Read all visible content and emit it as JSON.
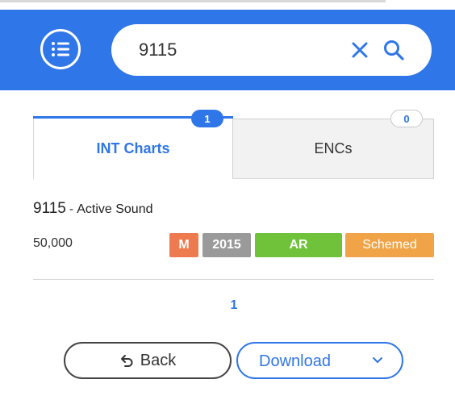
{
  "search": {
    "value": "9115"
  },
  "tabs": [
    {
      "label": "INT Charts",
      "count": "1",
      "active": true
    },
    {
      "label": "ENCs",
      "count": "0",
      "active": false
    }
  ],
  "chart": {
    "number": "9115",
    "separator": " - ",
    "name": "Active Sound",
    "scale": "50,000",
    "tags": {
      "type": "M",
      "year": "2015",
      "region": "AR",
      "status": "Schemed"
    }
  },
  "pagination": {
    "current": "1"
  },
  "actions": {
    "back_label": "Back",
    "download_label": "Download"
  },
  "icons": {
    "menu": "list-menu-icon",
    "clear": "close-icon",
    "search": "search-icon",
    "back": "undo-arrow-icon",
    "dropdown": "chevron-down-icon"
  },
  "colors": {
    "accent": "#2f76e8",
    "tag_type": "#ee7a4f",
    "tag_year": "#9a9a9a",
    "tag_region": "#6fc23a",
    "tag_status": "#f0a447"
  }
}
